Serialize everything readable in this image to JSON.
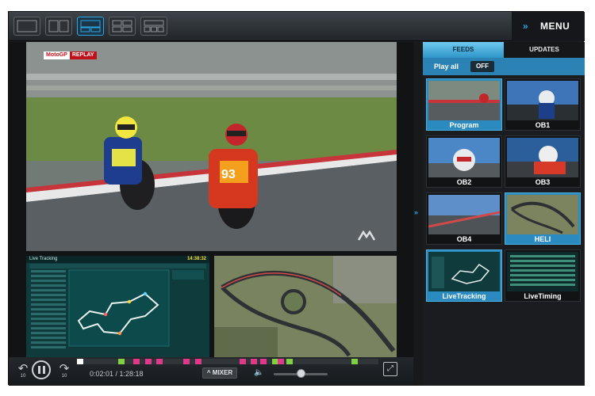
{
  "app": {
    "menu_label": "MENU",
    "layouts": [
      "layout-single-icon",
      "layout-split-icon",
      "layout-main-sub-icon",
      "layout-quad-icon",
      "layout-multi-icon"
    ],
    "active_layout_index": 2
  },
  "main_video": {
    "logo_text": "MotoGP",
    "replay_text": "REPLAY"
  },
  "live_tracking_panel": {
    "title": "Live Tracking",
    "time": "14:38:32"
  },
  "controls": {
    "rewind_seconds": "10",
    "forward_seconds": "10",
    "time": "0:02:01 / 1:28:18",
    "mixer_label": "MIXER",
    "volume_level": 0.5,
    "timeline_markers": [
      {
        "at": 0.0,
        "color": "#ffffff"
      },
      {
        "at": 0.14,
        "color": "#7fd142"
      },
      {
        "at": 0.19,
        "color": "#e0398a"
      },
      {
        "at": 0.23,
        "color": "#e0398a"
      },
      {
        "at": 0.27,
        "color": "#e0398a"
      },
      {
        "at": 0.36,
        "color": "#e0398a"
      },
      {
        "at": 0.4,
        "color": "#e0398a"
      },
      {
        "at": 0.55,
        "color": "#e0398a"
      },
      {
        "at": 0.59,
        "color": "#e0398a"
      },
      {
        "at": 0.62,
        "color": "#e0398a"
      },
      {
        "at": 0.66,
        "color": "#7fd142"
      },
      {
        "at": 0.68,
        "color": "#e0398a"
      },
      {
        "at": 0.71,
        "color": "#7fd142"
      },
      {
        "at": 0.93,
        "color": "#7fd142"
      }
    ]
  },
  "sidebar": {
    "tabs": [
      {
        "label": "FEEDS",
        "active": true
      },
      {
        "label": "UPDATES",
        "active": false
      }
    ],
    "play_all_label": "Play all",
    "play_all_state": "OFF",
    "feeds": [
      {
        "name": "Program",
        "selected": true
      },
      {
        "name": "OB1",
        "selected": false
      },
      {
        "name": "OB2",
        "selected": false
      },
      {
        "name": "OB3",
        "selected": false
      },
      {
        "name": "OB4",
        "selected": false
      },
      {
        "name": "HELI",
        "selected": true
      },
      {
        "name": "LiveTracking",
        "selected": true
      },
      {
        "name": "LiveTiming",
        "selected": false
      }
    ]
  },
  "colors": {
    "accent": "#28a6e6",
    "selected_feed": "#2b8bc0",
    "toolbar": "#2b2f33"
  }
}
